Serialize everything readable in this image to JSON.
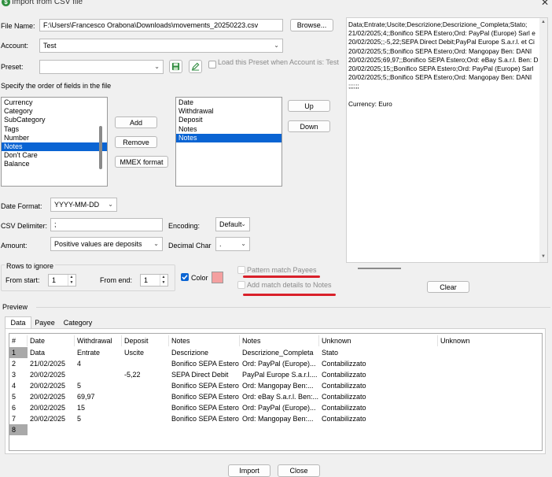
{
  "window": {
    "title": "Import from CSV file",
    "icon_glyph": "$",
    "close_glyph": "✕"
  },
  "form": {
    "file_name_label": "File Name:",
    "file_name_value": "F:\\Users\\Francesco Orabona\\Downloads\\movements_20250223.csv",
    "browse_label": "Browse...",
    "account_label": "Account:",
    "account_value": "Test",
    "preset_label": "Preset:",
    "preset_value": "",
    "load_preset_label": "Load this Preset when Account is: Test",
    "fields_order_label": "Specify the order of fields in the file"
  },
  "available_fields": [
    "Currency",
    "Category",
    "SubCategory",
    "Tags",
    "Number",
    "Notes",
    "Don't Care",
    "Balance"
  ],
  "available_selected": 5,
  "field_buttons": {
    "add": "Add",
    "remove": "Remove",
    "mmex": "MMEX format"
  },
  "selected_fields": [
    "Date",
    "Withdrawal",
    "Deposit",
    "Notes",
    "Notes"
  ],
  "selected_selected": 4,
  "order_buttons": {
    "up": "Up",
    "down": "Down"
  },
  "options": {
    "date_format_label": "Date Format:",
    "date_format_value": "YYYY-MM-DD",
    "csv_delim_label": "CSV Delimiter:",
    "csv_delim_value": ";",
    "encoding_label": "Encoding:",
    "encoding_value": "Default",
    "amount_label": "Amount:",
    "amount_value": "Positive values are deposits",
    "decimal_label": "Decimal Char",
    "decimal_value": "."
  },
  "rows_ignore": {
    "title": "Rows to ignore",
    "from_start_label": "From start:",
    "from_start_value": "1",
    "from_end_label": "From end:",
    "from_end_value": "1"
  },
  "color": {
    "label": "Color",
    "swatch": "#f4a0a0",
    "check_color": "#0a64d3"
  },
  "pattern_match_label": "Pattern match Payees",
  "add_match_label": "Add match details to Notes",
  "preview_text_lines": [
    "Data;Entrate;Uscite;Descrizione;Descrizione_Completa;Stato;",
    "21/02/2025;4;;Bonifico SEPA Estero;Ord: PayPal (Europe) Sarl e",
    "20/02/2025;;-5,22;SEPA Direct Debit;PayPal Europe S.a.r.l. et Ci",
    "20/02/2025;5;;Bonifico SEPA Estero;Ord: Mangopay Ben: DANI",
    "20/02/2025;69,97;;Bonifico SEPA Estero;Ord: eBay S.a.r.l. Ben: D",
    "20/02/2025;15;;Bonifico SEPA Estero;Ord: PayPal (Europe) Sarl",
    "20/02/2025;5;;Bonifico SEPA Estero;Ord: Mangopay Ben: DANI",
    ";;;;;;",
    "",
    "Currency: Euro"
  ],
  "clear_label": "Clear",
  "preview_label": "Preview",
  "tabs": [
    "Data",
    "Payee",
    "Category"
  ],
  "grid": {
    "headers": [
      "#",
      "Date",
      "Withdrawal",
      "Deposit",
      "Notes",
      "Notes",
      "Unknown",
      "Unknown"
    ],
    "rows": [
      [
        "1",
        "Data",
        "Entrate",
        "Uscite",
        "Descrizione",
        "Descrizione_Completa",
        "Stato",
        ""
      ],
      [
        "2",
        "21/02/2025",
        "4",
        "",
        "Bonifico SEPA Estero",
        "Ord: PayPal (Europe)...",
        "Contabilizzato",
        ""
      ],
      [
        "3",
        "20/02/2025",
        "",
        "-5,22",
        "SEPA Direct Debit",
        "PayPal Europe S.a.r.l....",
        "Contabilizzato",
        ""
      ],
      [
        "4",
        "20/02/2025",
        "5",
        "",
        "Bonifico SEPA Estero",
        "Ord: Mangopay Ben:...",
        "Contabilizzato",
        ""
      ],
      [
        "5",
        "20/02/2025",
        "69,97",
        "",
        "Bonifico SEPA Estero",
        "Ord: eBay S.a.r.l. Ben:...",
        "Contabilizzato",
        ""
      ],
      [
        "6",
        "20/02/2025",
        "15",
        "",
        "Bonifico SEPA Estero",
        "Ord: PayPal (Europe)...",
        "Contabilizzato",
        ""
      ],
      [
        "7",
        "20/02/2025",
        "5",
        "",
        "Bonifico SEPA Estero",
        "Ord: Mangopay Ben:...",
        "Contabilizzato",
        ""
      ],
      [
        "8",
        "",
        "",
        "",
        "",
        "",
        "",
        ""
      ]
    ]
  },
  "bottom_buttons": {
    "import": "Import",
    "close": "Close"
  },
  "colors": {
    "accent": "#0a64d3",
    "annotation_red": "#d9202a",
    "row_gray": "#c4c4c4",
    "row_light": "#e8e8e8"
  },
  "icons": [
    "save-icon",
    "edit-icon",
    "chevron-down-icon",
    "close-icon"
  ]
}
